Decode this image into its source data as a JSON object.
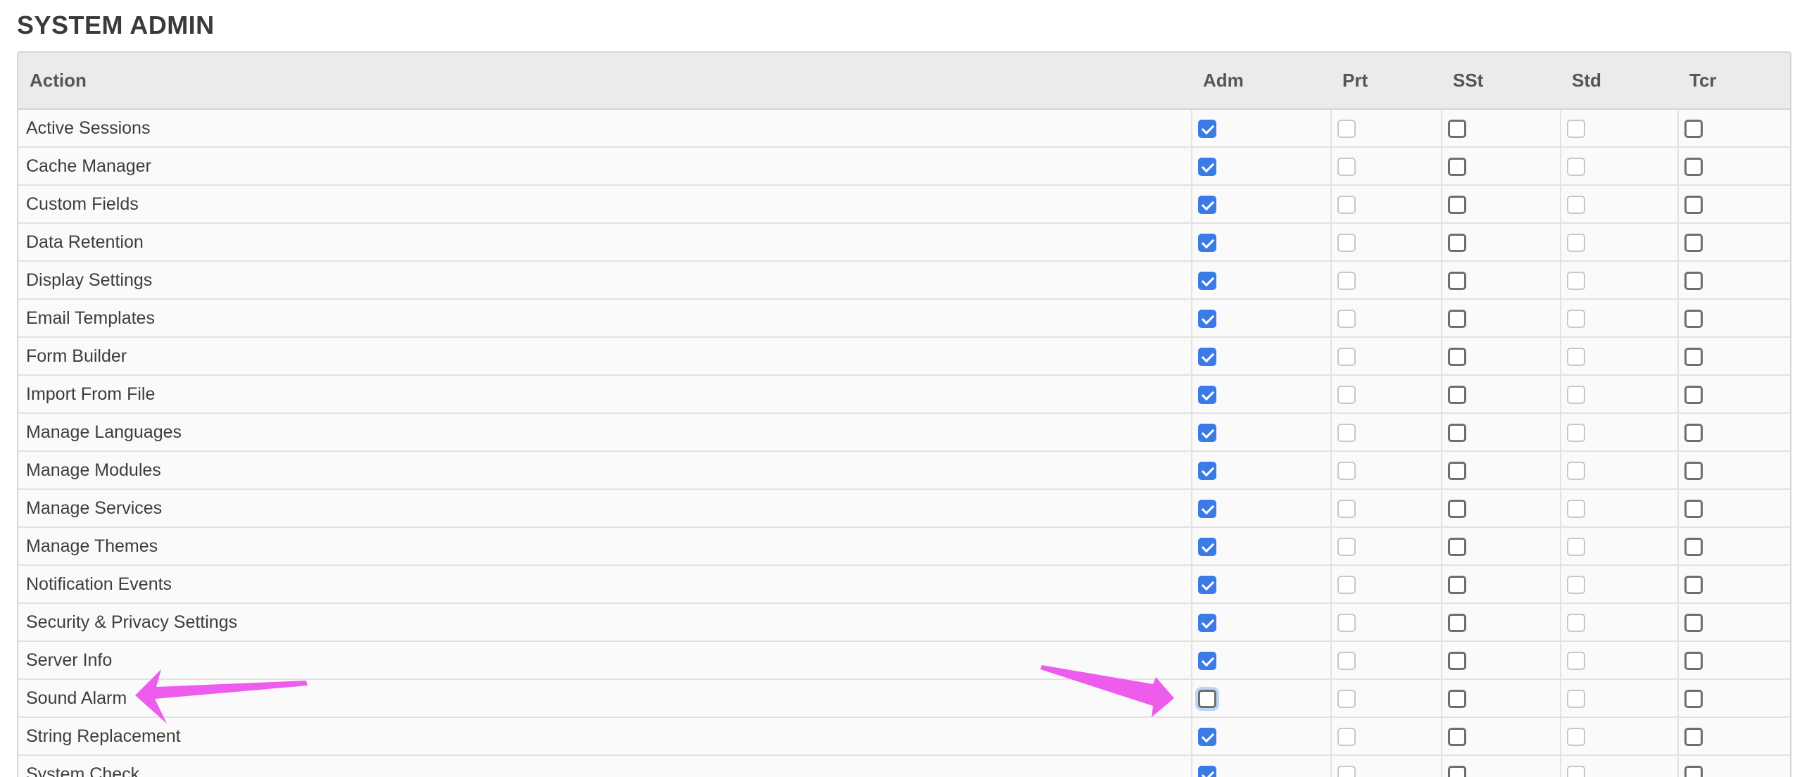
{
  "section": {
    "title": "SYSTEM ADMIN"
  },
  "table": {
    "headers": {
      "action": "Action",
      "adm": "Adm",
      "prt": "Prt",
      "sst": "SSt",
      "std": "Std",
      "tcr": "Tcr"
    },
    "rows": [
      {
        "label": "Active Sessions",
        "adm": "checked",
        "prt": "disabled",
        "sst": "unchecked",
        "std": "disabled",
        "tcr": "unchecked"
      },
      {
        "label": "Cache Manager",
        "adm": "checked",
        "prt": "disabled",
        "sst": "unchecked",
        "std": "disabled",
        "tcr": "unchecked"
      },
      {
        "label": "Custom Fields",
        "adm": "checked",
        "prt": "disabled",
        "sst": "unchecked",
        "std": "disabled",
        "tcr": "unchecked"
      },
      {
        "label": "Data Retention",
        "adm": "checked",
        "prt": "disabled",
        "sst": "unchecked",
        "std": "disabled",
        "tcr": "unchecked"
      },
      {
        "label": "Display Settings",
        "adm": "checked",
        "prt": "disabled",
        "sst": "unchecked",
        "std": "disabled",
        "tcr": "unchecked"
      },
      {
        "label": "Email Templates",
        "adm": "checked",
        "prt": "disabled",
        "sst": "unchecked",
        "std": "disabled",
        "tcr": "unchecked"
      },
      {
        "label": "Form Builder",
        "adm": "checked",
        "prt": "disabled",
        "sst": "unchecked",
        "std": "disabled",
        "tcr": "unchecked"
      },
      {
        "label": "Import From File",
        "adm": "checked",
        "prt": "disabled",
        "sst": "unchecked",
        "std": "disabled",
        "tcr": "unchecked"
      },
      {
        "label": "Manage Languages",
        "adm": "checked",
        "prt": "disabled",
        "sst": "unchecked",
        "std": "disabled",
        "tcr": "unchecked"
      },
      {
        "label": "Manage Modules",
        "adm": "checked",
        "prt": "disabled",
        "sst": "unchecked",
        "std": "disabled",
        "tcr": "unchecked"
      },
      {
        "label": "Manage Services",
        "adm": "checked",
        "prt": "disabled",
        "sst": "unchecked",
        "std": "disabled",
        "tcr": "unchecked"
      },
      {
        "label": "Manage Themes",
        "adm": "checked",
        "prt": "disabled",
        "sst": "unchecked",
        "std": "disabled",
        "tcr": "unchecked"
      },
      {
        "label": "Notification Events",
        "adm": "checked",
        "prt": "disabled",
        "sst": "unchecked",
        "std": "disabled",
        "tcr": "unchecked"
      },
      {
        "label": "Security & Privacy Settings",
        "adm": "checked",
        "prt": "disabled",
        "sst": "unchecked",
        "std": "disabled",
        "tcr": "unchecked"
      },
      {
        "label": "Server Info",
        "adm": "checked",
        "prt": "disabled",
        "sst": "unchecked",
        "std": "disabled",
        "tcr": "unchecked"
      },
      {
        "label": "Sound Alarm",
        "adm": "focused",
        "prt": "disabled",
        "sst": "unchecked",
        "std": "disabled",
        "tcr": "unchecked"
      },
      {
        "label": "String Replacement",
        "adm": "checked",
        "prt": "disabled",
        "sst": "unchecked",
        "std": "disabled",
        "tcr": "unchecked"
      },
      {
        "label": "System Check",
        "adm": "checked",
        "prt": "disabled",
        "sst": "unchecked",
        "std": "disabled",
        "tcr": "unchecked"
      }
    ]
  },
  "annotations": {
    "arrow_color": "#ee5ced"
  },
  "colors": {
    "checkbox_checked": "#3a7be8",
    "checkbox_focus_ring": "#bcd4f6",
    "header_bg": "#ebebeb"
  }
}
